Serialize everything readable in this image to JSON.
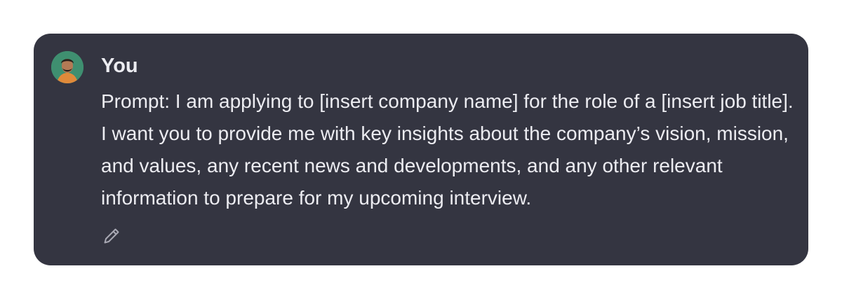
{
  "message": {
    "author": "You",
    "text": "Prompt: I am applying to [insert company name] for the role of a [insert job title]. I want you to provide me with key insights about the company’s vision, mission, and values, any recent news and developments, and any other relevant information to prepare for my upcoming interview.",
    "avatar_icon": "user-photo-avatar",
    "edit_icon": "pencil-icon"
  },
  "colors": {
    "card_background": "#343541",
    "text": "#ececf1",
    "icon": "#a8a8b3",
    "avatar_background": "#3f8f70"
  }
}
